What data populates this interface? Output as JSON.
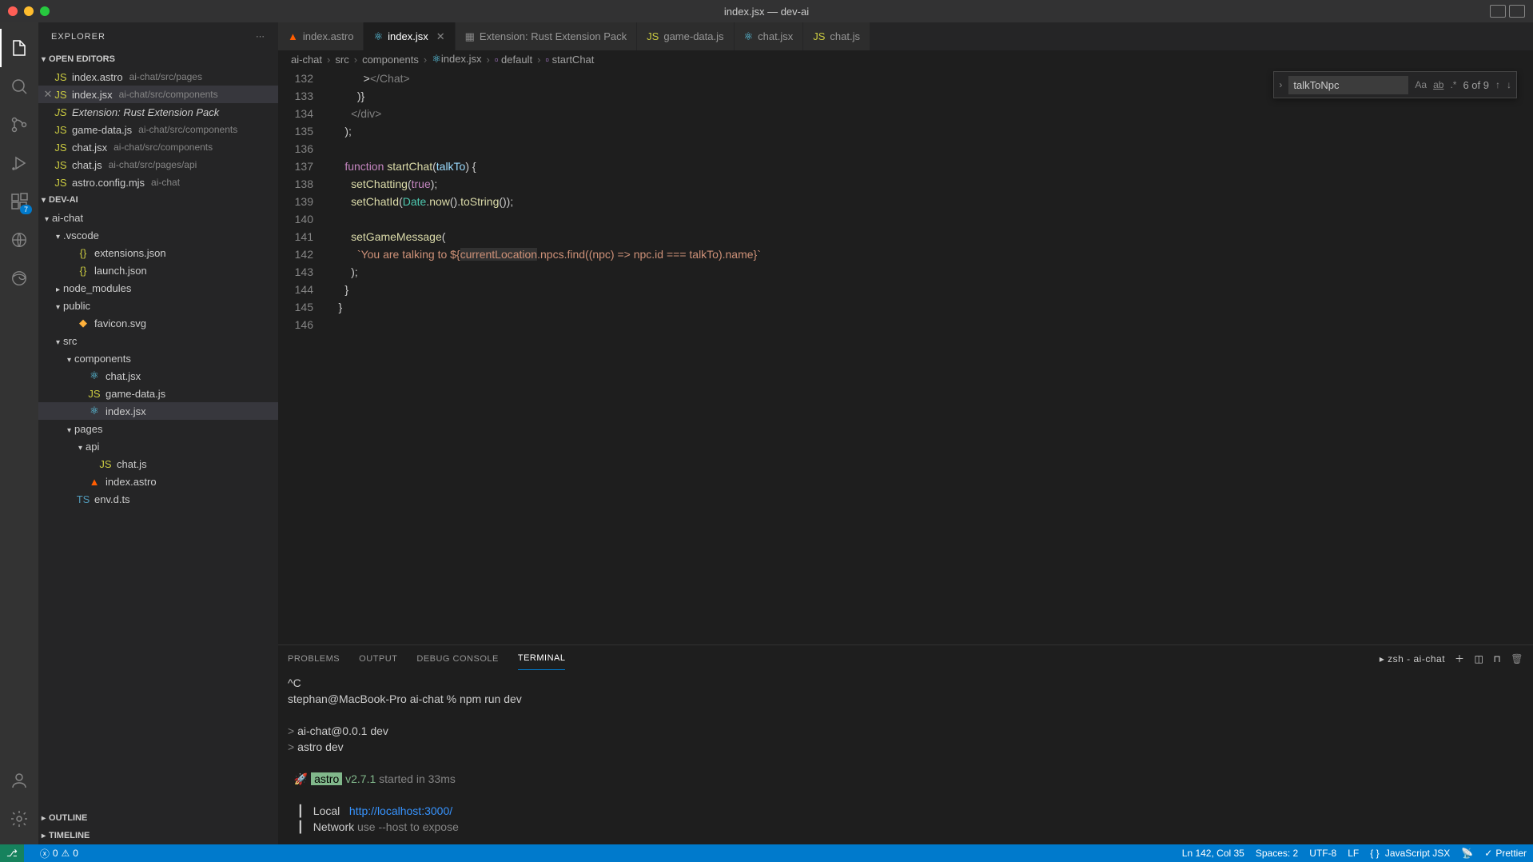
{
  "window": {
    "title": "index.jsx — dev-ai"
  },
  "sidebar": {
    "title": "EXPLORER",
    "sections": {
      "open_editors": {
        "label": "OPEN EDITORS",
        "items": [
          {
            "name": "index.astro",
            "desc": "ai-chat/src/pages"
          },
          {
            "name": "index.jsx",
            "desc": "ai-chat/src/components"
          },
          {
            "name": "Extension: Rust Extension Pack",
            "desc": ""
          },
          {
            "name": "game-data.js",
            "desc": "ai-chat/src/components"
          },
          {
            "name": "chat.jsx",
            "desc": "ai-chat/src/components"
          },
          {
            "name": "chat.js",
            "desc": "ai-chat/src/pages/api"
          },
          {
            "name": "astro.config.mjs",
            "desc": "ai-chat"
          }
        ]
      },
      "project": {
        "label": "DEV-AI",
        "tree": [
          {
            "depth": 0,
            "name": "ai-chat",
            "folder": true,
            "open": true
          },
          {
            "depth": 1,
            "name": ".vscode",
            "folder": true,
            "open": true
          },
          {
            "depth": 2,
            "name": "extensions.json",
            "icon": "json"
          },
          {
            "depth": 2,
            "name": "launch.json",
            "icon": "json"
          },
          {
            "depth": 1,
            "name": "node_modules",
            "folder": true,
            "open": false
          },
          {
            "depth": 1,
            "name": "public",
            "folder": true,
            "open": true
          },
          {
            "depth": 2,
            "name": "favicon.svg",
            "icon": "svg"
          },
          {
            "depth": 1,
            "name": "src",
            "folder": true,
            "open": true
          },
          {
            "depth": 2,
            "name": "components",
            "folder": true,
            "open": true
          },
          {
            "depth": 3,
            "name": "chat.jsx",
            "icon": "react"
          },
          {
            "depth": 3,
            "name": "game-data.js",
            "icon": "js"
          },
          {
            "depth": 3,
            "name": "index.jsx",
            "icon": "react",
            "selected": true
          },
          {
            "depth": 2,
            "name": "pages",
            "folder": true,
            "open": true
          },
          {
            "depth": 3,
            "name": "api",
            "folder": true,
            "open": true
          },
          {
            "depth": 4,
            "name": "chat.js",
            "icon": "js"
          },
          {
            "depth": 3,
            "name": "index.astro",
            "icon": "astro"
          },
          {
            "depth": 2,
            "name": "env.d.ts",
            "icon": "ts"
          }
        ]
      },
      "outline": {
        "label": "OUTLINE"
      },
      "timeline": {
        "label": "TIMELINE"
      }
    }
  },
  "activity_badge": "7",
  "tabs": [
    {
      "label": "index.astro",
      "icon": "astro"
    },
    {
      "label": "index.jsx",
      "icon": "react",
      "active": true
    },
    {
      "label": "Extension: Rust Extension Pack",
      "icon": "ext",
      "italic": true
    },
    {
      "label": "game-data.js",
      "icon": "js"
    },
    {
      "label": "chat.jsx",
      "icon": "react"
    },
    {
      "label": "chat.js",
      "icon": "js"
    }
  ],
  "breadcrumbs": [
    "ai-chat",
    "src",
    "components",
    "index.jsx",
    "default",
    "startChat"
  ],
  "editor": {
    "first_line": 132,
    "lines": [
      "            ></Chat>",
      "          )}",
      "        </div>",
      "      );",
      "",
      "      function startChat(talkTo) {",
      "        setChatting(true);",
      "        setChatId(Date.now().toString());",
      "",
      "        setGameMessage(",
      "          `You are talking to ${currentLocation.npcs.find((npc) => npc.id === talkTo).name}`",
      "        );",
      "      }",
      "    }",
      ""
    ]
  },
  "search": {
    "value": "talkToNpc",
    "count": "6 of 9"
  },
  "panel": {
    "tabs": [
      "PROBLEMS",
      "OUTPUT",
      "DEBUG CONSOLE",
      "TERMINAL"
    ],
    "active_tab": "TERMINAL",
    "shell_label": "zsh - ai-chat",
    "terminal": {
      "lines": [
        {
          "t": "^C"
        },
        {
          "t": "stephan@MacBook-Pro ai-chat % npm run dev"
        },
        {
          "t": ""
        },
        {
          "prompt": "> ",
          "t": "ai-chat@0.0.1 dev"
        },
        {
          "prompt": "> ",
          "t": "astro dev"
        },
        {
          "t": ""
        },
        {
          "astro": true,
          "version": "v2.7.1",
          "rest": " started in 33ms"
        },
        {
          "t": ""
        },
        {
          "label": "  Local   ",
          "link": "http://localhost:3000/"
        },
        {
          "label": "  Network ",
          "dim": "use --host to expose"
        }
      ]
    }
  },
  "status": {
    "errors": "0",
    "warnings": "0",
    "position": "Ln 142, Col 35",
    "spaces": "Spaces: 2",
    "encoding": "UTF-8",
    "eol": "LF",
    "lang": "JavaScript JSX",
    "prettier": "Prettier"
  }
}
